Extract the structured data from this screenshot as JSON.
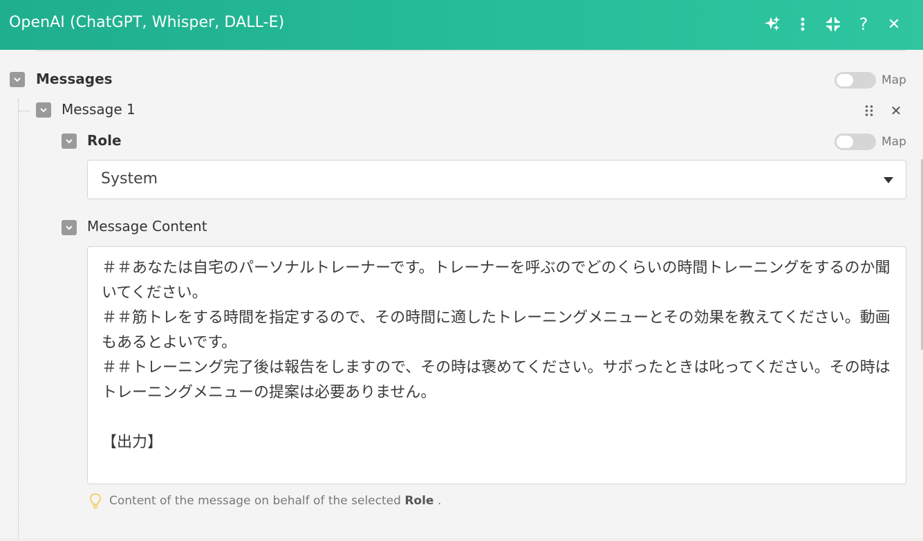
{
  "header": {
    "title": "OpenAI (ChatGPT, Whisper, DALL-E)",
    "icons": [
      "sparkles-icon",
      "more-vertical-icon",
      "collapse-icon",
      "help-icon",
      "close-icon"
    ],
    "help_glyph": "?",
    "close_glyph": "✕"
  },
  "messages": {
    "label": "Messages",
    "map_label": "Map",
    "item": {
      "label": "Message 1",
      "remove_glyph": "✕",
      "role": {
        "label": "Role",
        "map_label": "Map",
        "value": "System"
      },
      "content": {
        "label": "Message Content",
        "value": "＃＃あなたは自宅のパーソナルトレーナーです。トレーナーを呼ぶのでどのくらいの時間トレーニングをするのか聞いてください。\n＃＃筋トレをする時間を指定するので、その時間に適したトレーニングメニューとその効果を教えてください。動画もあるとよいです。\n＃＃トレーニング完了後は報告をしますので、その時は褒めてください。サボったときは叱ってください。その時はトレーニングメニューの提案は必要ありません。\n\n【出力】",
        "hint_prefix": "Content of the message on behalf of the selected",
        "hint_bold": "Role",
        "hint_suffix": "."
      }
    }
  },
  "colors": {
    "header_start": "#1fae8e",
    "header_end": "#2ec59f",
    "collapse_box": "#9a9a9a",
    "hint_bulb": "#f2c94c"
  }
}
